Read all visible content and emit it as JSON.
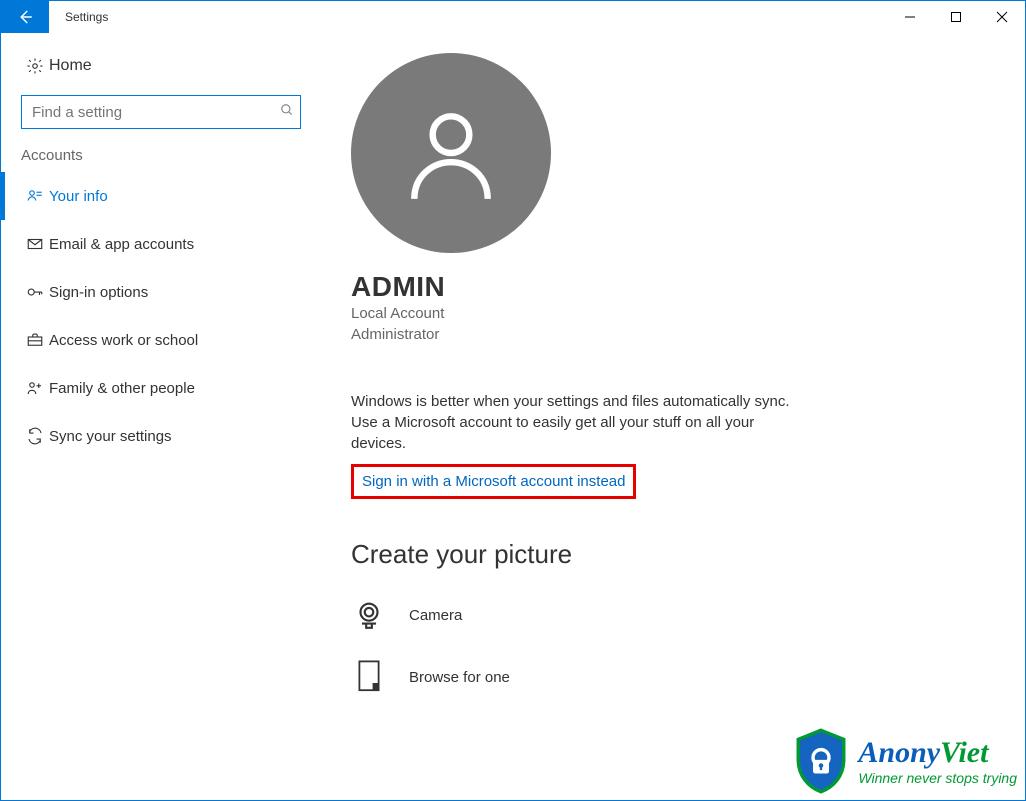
{
  "window": {
    "title": "Settings"
  },
  "sidebar": {
    "home": "Home",
    "searchPlaceholder": "Find a setting",
    "sectionHeader": "Accounts",
    "items": [
      {
        "label": "Your info"
      },
      {
        "label": "Email & app accounts"
      },
      {
        "label": "Sign-in options"
      },
      {
        "label": "Access work or school"
      },
      {
        "label": "Family & other people"
      },
      {
        "label": "Sync your settings"
      }
    ]
  },
  "account": {
    "name": "ADMIN",
    "typeLine1": "Local Account",
    "typeLine2": "Administrator",
    "promptText": "Windows is better when your settings and files automatically sync. Use a Microsoft account to easily get all your stuff on all your devices.",
    "signinLink": "Sign in with a Microsoft account instead",
    "createPictureHeader": "Create your picture",
    "options": [
      {
        "label": "Camera"
      },
      {
        "label": "Browse for one"
      }
    ]
  },
  "watermark": {
    "brandPart1": "Anony",
    "brandPart2": "Viet",
    "tagline": "Winner never stops trying"
  }
}
